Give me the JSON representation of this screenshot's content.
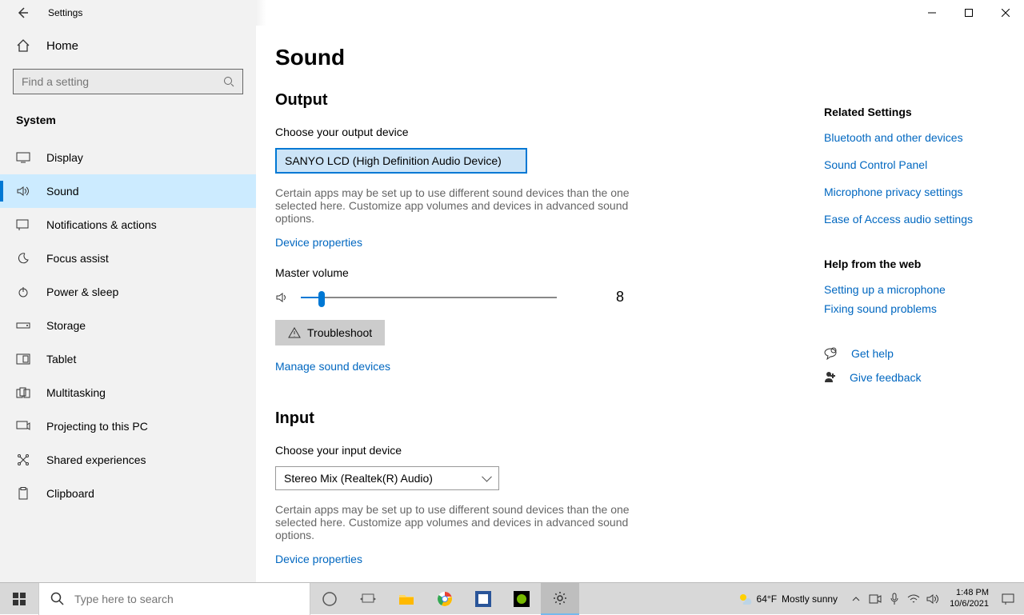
{
  "window": {
    "title": "Settings"
  },
  "sidebar": {
    "home": "Home",
    "search_placeholder": "Find a setting",
    "section": "System",
    "items": [
      {
        "label": "Display"
      },
      {
        "label": "Sound"
      },
      {
        "label": "Notifications & actions"
      },
      {
        "label": "Focus assist"
      },
      {
        "label": "Power & sleep"
      },
      {
        "label": "Storage"
      },
      {
        "label": "Tablet"
      },
      {
        "label": "Multitasking"
      },
      {
        "label": "Projecting to this PC"
      },
      {
        "label": "Shared experiences"
      },
      {
        "label": "Clipboard"
      }
    ]
  },
  "page": {
    "title": "Sound",
    "output": {
      "heading": "Output",
      "choose_label": "Choose your output device",
      "selected_device": "SANYO LCD (High Definition Audio Device)",
      "help": "Certain apps may be set up to use different sound devices than the one selected here. Customize app volumes and devices in advanced sound options.",
      "properties_link": "Device properties",
      "volume_label": "Master volume",
      "volume_value": "8",
      "volume_percent": 8,
      "troubleshoot": "Troubleshoot",
      "manage_link": "Manage sound devices"
    },
    "input": {
      "heading": "Input",
      "choose_label": "Choose your input device",
      "selected_device": "Stereo Mix (Realtek(R) Audio)",
      "help": "Certain apps may be set up to use different sound devices than the one selected here. Customize app volumes and devices in advanced sound options.",
      "properties_link": "Device properties"
    }
  },
  "rail": {
    "related_heading": "Related Settings",
    "related_links": [
      "Bluetooth and other devices",
      "Sound Control Panel",
      "Microphone privacy settings",
      "Ease of Access audio settings"
    ],
    "help_heading": "Help from the web",
    "help_links": [
      "Setting up a microphone",
      "Fixing sound problems"
    ],
    "get_help": "Get help",
    "give_feedback": "Give feedback"
  },
  "taskbar": {
    "search_placeholder": "Type here to search",
    "weather_temp": "64°F",
    "weather_desc": "Mostly sunny",
    "time": "1:48 PM",
    "date": "10/6/2021"
  }
}
